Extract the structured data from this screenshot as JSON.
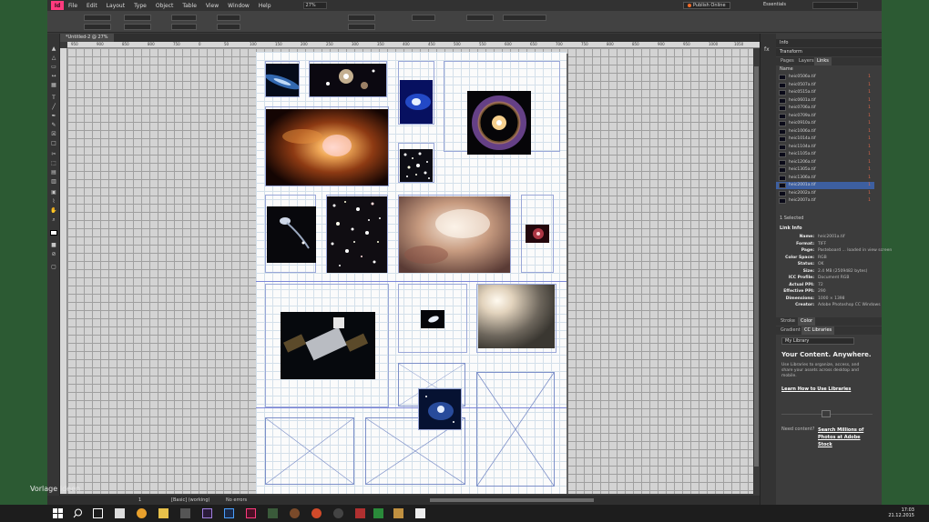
{
  "watermark": "Vorlage Ideen",
  "app": {
    "logo": "Id",
    "menu": [
      "File",
      "Edit",
      "Layout",
      "Type",
      "Object",
      "Table",
      "View",
      "Window",
      "Help"
    ],
    "zoom": "27%",
    "publish_button": "Publish Online",
    "workspace": "Essentials"
  },
  "document": {
    "tab": "*Untitled-2 @ 27%",
    "ruler_ticks": [
      "950",
      "900",
      "850",
      "800",
      "750",
      "0",
      "50",
      "100",
      "150",
      "200",
      "250",
      "300",
      "350",
      "400",
      "450",
      "500",
      "550",
      "600",
      "650",
      "700",
      "750",
      "800",
      "850",
      "900",
      "950",
      "1000",
      "1050"
    ]
  },
  "status": {
    "page": "1",
    "preflight": "[Basic] (working)",
    "errors": "No errors"
  },
  "panel_strip": [
    "fx"
  ],
  "panels": {
    "info_header": "Info",
    "transform_header": "Transform",
    "tabs": [
      "Pages",
      "Layers",
      "Links"
    ],
    "links_column": "Name",
    "links": [
      {
        "name": "heic0506a.tif",
        "page": "1"
      },
      {
        "name": "heic0507a.tif",
        "page": "1"
      },
      {
        "name": "heic0515a.tif",
        "page": "1"
      },
      {
        "name": "heic0601a.tif",
        "page": "1"
      },
      {
        "name": "heic0706a.tif",
        "page": "1"
      },
      {
        "name": "heic0709a.tif",
        "page": "1"
      },
      {
        "name": "heic0910a.tif",
        "page": "1"
      },
      {
        "name": "heic1006a.tif",
        "page": "1"
      },
      {
        "name": "heic1014a.tif",
        "page": "1"
      },
      {
        "name": "heic1104a.tif",
        "page": "1"
      },
      {
        "name": "heic1105a.tif",
        "page": "1"
      },
      {
        "name": "heic1206a.tif",
        "page": "1"
      },
      {
        "name": "heic1305a.tif",
        "page": "1"
      },
      {
        "name": "heic1306a.tif",
        "page": "1"
      },
      {
        "name": "heic2001a.tif",
        "page": "1"
      },
      {
        "name": "heic2002a.tif",
        "page": "1"
      },
      {
        "name": "heic2007a.tif",
        "page": "1"
      }
    ],
    "selected_count": "1 Selected",
    "link_info_title": "Link Info",
    "link_info": [
      {
        "k": "Name:",
        "v": "heic2001a.tif"
      },
      {
        "k": "Format:",
        "v": "TIFF"
      },
      {
        "k": "Page:",
        "v": "Pasteboard ... loaded in view screen"
      },
      {
        "k": "Color Space:",
        "v": "RGB"
      },
      {
        "k": "Status:",
        "v": "OK"
      },
      {
        "k": "Size:",
        "v": "2.4 MB (2509482 bytes)"
      },
      {
        "k": "ICC Profile:",
        "v": "Document RGB"
      },
      {
        "k": "Actual PPI:",
        "v": "72"
      },
      {
        "k": "Effective PPI:",
        "v": "290"
      },
      {
        "k": "Dimensions:",
        "v": "1000 × 1398"
      },
      {
        "k": "Creator:",
        "v": "Adobe Photoshop CC Windows"
      }
    ],
    "swatch_tabs": [
      "Stroke",
      "Color"
    ],
    "cc_tabs": [
      "Gradient",
      "CC Libraries"
    ],
    "library_select": "My Library",
    "library_heading": "Your Content. Anywhere.",
    "library_text": "Use Libraries to organize, access, and share your assets across desktop and mobile.",
    "library_link": "Learn How to Use Libraries",
    "stock_prompt": "Need content?",
    "stock_link": "Search Millions of Photos at Adobe Stock"
  },
  "taskbar": {
    "time": "17:03",
    "date": "21.12.2015"
  }
}
